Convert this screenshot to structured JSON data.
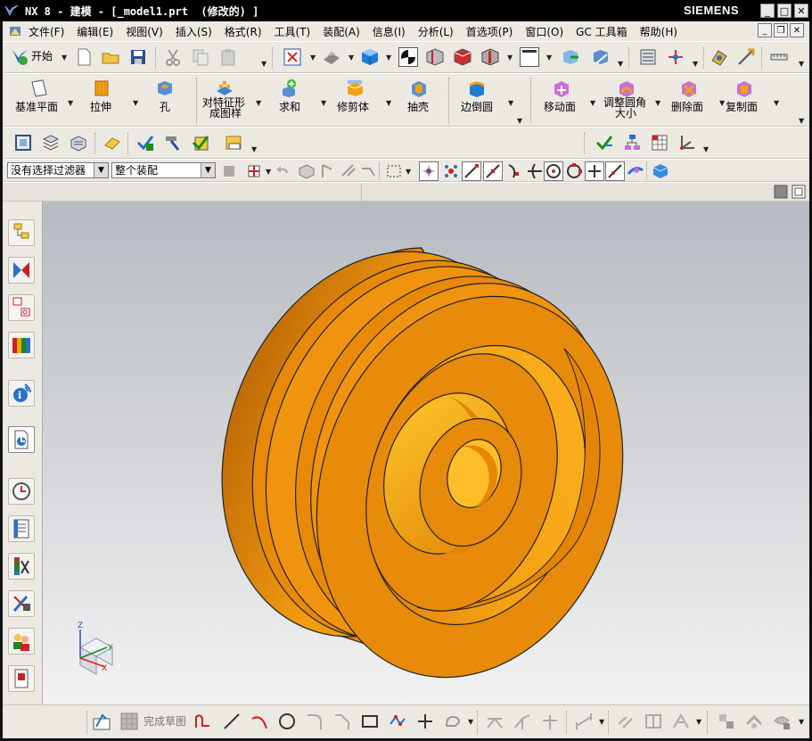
{
  "window": {
    "title": "NX 8 - 建模 - [_model1.prt  (修改的) ]",
    "brand": "SIEMENS",
    "minimize": "_",
    "maximize": "□",
    "close": "✕"
  },
  "menubar": {
    "items": [
      "文件(F)",
      "编辑(E)",
      "视图(V)",
      "插入(S)",
      "格式(R)",
      "工具(T)",
      "装配(A)",
      "信息(I)",
      "分析(L)",
      "首选项(P)",
      "窗口(O)",
      "GC 工具箱",
      "帮助(H)"
    ]
  },
  "toolbar_standard": {
    "start_label": "开始"
  },
  "toolbar_features": {
    "buttons": [
      {
        "label": "基准平面",
        "icon": "datum-plane-icon"
      },
      {
        "label": "拉伸",
        "icon": "extrude-icon"
      },
      {
        "label": "孔",
        "icon": "hole-icon"
      },
      {
        "label": "对特征形成图样",
        "line1": "对特征形",
        "line2": "成图样",
        "icon": "pattern-feature-icon"
      },
      {
        "label": "求和",
        "icon": "unite-icon"
      },
      {
        "label": "修剪体",
        "icon": "trim-body-icon"
      },
      {
        "label": "抽壳",
        "icon": "shell-icon"
      },
      {
        "label": "边倒圆",
        "icon": "edge-blend-icon"
      },
      {
        "label": "移动面",
        "icon": "move-face-icon"
      },
      {
        "label": "调整圆角大小",
        "line1": "调整圆角",
        "line2": "大小",
        "icon": "resize-blend-icon"
      },
      {
        "label": "删除面",
        "icon": "delete-face-icon"
      },
      {
        "label": "复制面",
        "icon": "copy-face-icon"
      }
    ]
  },
  "selection_bar": {
    "filter_value": "没有选择过滤器",
    "scope_value": "整个装配"
  },
  "sketch_bar": {
    "finish_sketch_label": "完成草图"
  },
  "triad": {
    "x": "X",
    "y": "Y",
    "z": "Z"
  },
  "colors": {
    "part_base": "#e88a0a",
    "part_light": "#fbb21c",
    "part_dark": "#c06c06",
    "viewport_top": "#b7bbc1",
    "viewport_bottom": "#f2f2f2",
    "chrome": "#ece9e3"
  }
}
